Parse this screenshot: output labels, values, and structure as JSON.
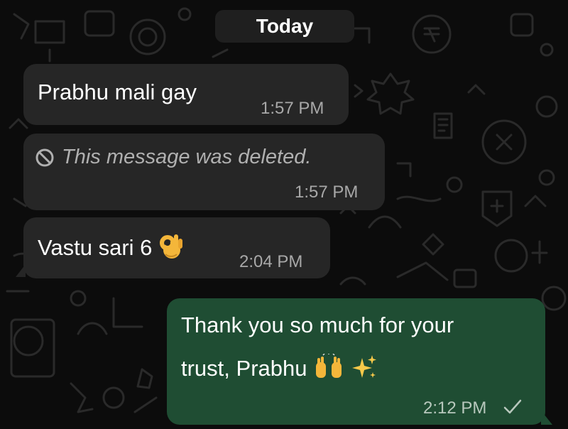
{
  "date_divider": "Today",
  "messages": [
    {
      "text": "Prabhu mali gay",
      "time": "1:57 PM"
    },
    {
      "text": "This message was deleted.",
      "time": "1:57 PM"
    },
    {
      "text": "Vastu sari 6",
      "time": "2:04 PM"
    },
    {
      "text_line1": "Thank you so much for your",
      "text_line2": "trust, Prabhu",
      "time": "2:12 PM"
    }
  ],
  "icons": {
    "deleted": "block-icon",
    "ok_hand": "ok-hand-emoji",
    "raising_hands": "raising-hands-emoji",
    "sparkles": "sparkles-emoji",
    "sent_check": "check-icon"
  },
  "colors": {
    "background": "#0c0c0c",
    "incoming_bubble": "#262626",
    "outgoing_bubble": "#1f4d33",
    "timestamp": "#a8a8a8"
  }
}
